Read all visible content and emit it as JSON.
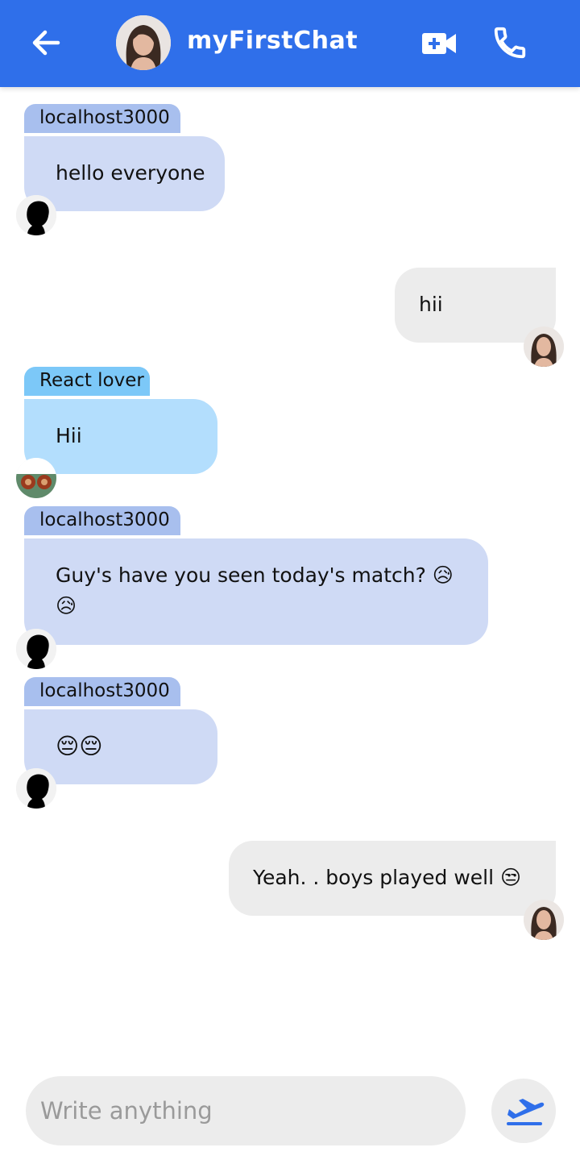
{
  "header": {
    "title": "myFirstChat",
    "back_icon": "arrow-left-icon",
    "video_icon": "video-plus-icon",
    "call_icon": "phone-icon",
    "color": "#2f6fea"
  },
  "messages": [
    {
      "sender": "localhost3000",
      "text": "hello everyone",
      "direction": "incoming"
    },
    {
      "text": "hii",
      "direction": "outgoing"
    },
    {
      "sender": "React lover",
      "text": "Hii",
      "direction": "incoming"
    },
    {
      "sender": "localhost3000",
      "text": "Guy's have you seen today's match? 😥",
      "text_line2": "😥",
      "direction": "incoming"
    },
    {
      "sender": "localhost3000",
      "text": "😔😔",
      "direction": "incoming"
    },
    {
      "text": "Yeah. . boys played well 😒",
      "direction": "outgoing"
    }
  ],
  "composer": {
    "placeholder": "Write anything",
    "send_icon": "airplane-send-icon"
  }
}
